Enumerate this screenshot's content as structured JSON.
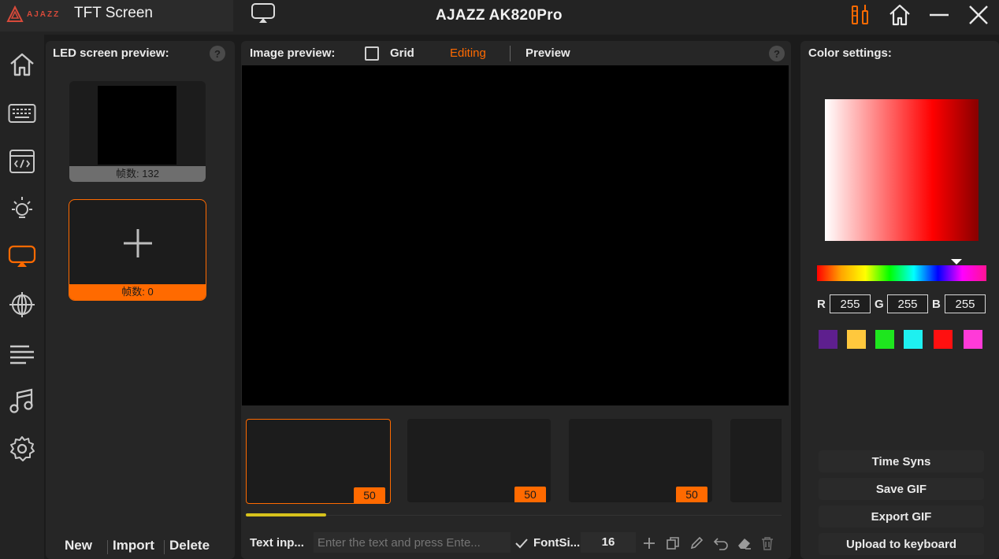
{
  "header": {
    "brand_name": "AJAZZ",
    "section_title": "TFT Screen",
    "app_title": "AJAZZ AK820Pro"
  },
  "nav": {
    "items": [
      {
        "name": "home"
      },
      {
        "name": "keyboard"
      },
      {
        "name": "macro"
      },
      {
        "name": "lighting"
      },
      {
        "name": "tft-screen",
        "active": true
      },
      {
        "name": "network"
      },
      {
        "name": "list"
      },
      {
        "name": "music"
      },
      {
        "name": "settings"
      }
    ]
  },
  "led_panel": {
    "title": "LED screen preview:",
    "help": "?",
    "slots": [
      {
        "frames_label": "帧数: 132"
      },
      {
        "frames_label": "帧数: 0",
        "plus": "+"
      }
    ],
    "new_label": "New",
    "import_label": "Import",
    "delete_label": "Delete"
  },
  "image_panel": {
    "title": "Image preview:",
    "grid_label": "Grid",
    "editing_label": "Editing",
    "preview_label": "Preview",
    "help": "?",
    "frames": [
      {
        "badge": "50"
      },
      {
        "badge": "50"
      },
      {
        "badge": "50"
      }
    ],
    "scroll_progress": 0.15,
    "text_input_label": "Text inp...",
    "text_placeholder": "Enter the text and press Ente...",
    "font_size_label": "FontSi...",
    "font_size_value": "16"
  },
  "color_panel": {
    "title": "Color settings:",
    "r_label": "R",
    "g_label": "G",
    "b_label": "B",
    "r_value": "255",
    "g_value": "255",
    "b_value": "255",
    "swatches": [
      "#5e1f8e",
      "#ffc83d",
      "#1ee61e",
      "#1ef0f0",
      "#ff1010",
      "#ff3ad8"
    ],
    "buttons": {
      "time_sync": "Time Syns",
      "save_gif": "Save GIF",
      "export_gif": "Export GIF",
      "upload": "Upload to keyboard"
    }
  },
  "colors": {
    "accent": "#ff6a00",
    "highlight_bar": "#d7c21c",
    "background": "#1b1b1b",
    "panel": "#262626"
  }
}
